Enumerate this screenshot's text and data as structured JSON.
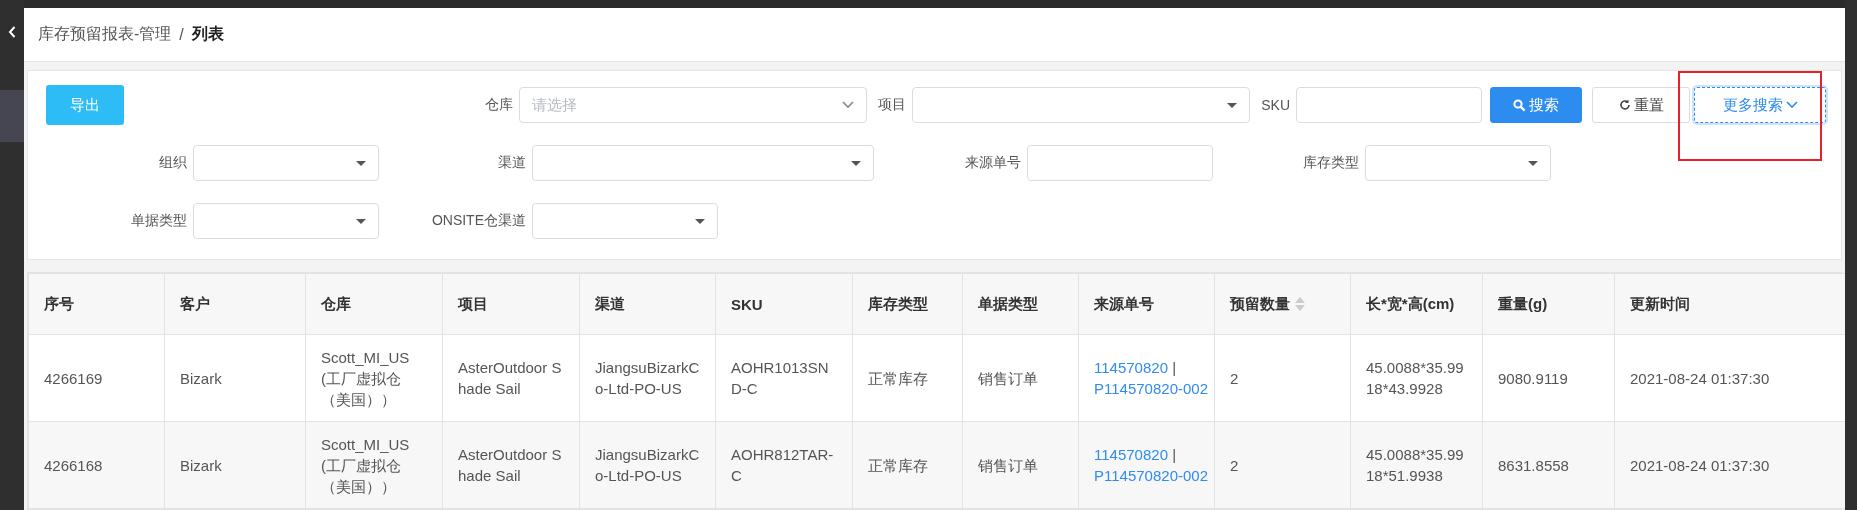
{
  "breadcrumb": {
    "parent": "库存预留报表-管理",
    "separator": "/",
    "current": "列表"
  },
  "filter_rows": [
    {
      "items": [
        {
          "kind": "export",
          "label": "导出"
        },
        {
          "kind": "select",
          "label": "仓库",
          "placeholder": "请选择"
        },
        {
          "kind": "dropdown",
          "label": "项目"
        },
        {
          "kind": "input",
          "label": "SKU"
        },
        {
          "kind": "search",
          "label": "搜索"
        },
        {
          "kind": "reset",
          "label": "重置"
        },
        {
          "kind": "more",
          "label": "更多搜索",
          "focused": true,
          "highlighted": true
        }
      ]
    },
    {
      "items": [
        {
          "kind": "dropdown",
          "label": "组织"
        },
        {
          "kind": "dropdown",
          "label": "渠道"
        },
        {
          "kind": "input",
          "label": "来源单号"
        },
        {
          "kind": "dropdown",
          "label": "库存类型"
        }
      ]
    },
    {
      "items": [
        {
          "kind": "dropdown",
          "label": "单据类型"
        },
        {
          "kind": "dropdown",
          "label": "ONSITE仓渠道"
        }
      ]
    }
  ],
  "table": {
    "columns": [
      {
        "label": "序号",
        "sortable": false
      },
      {
        "label": "客户",
        "sortable": false
      },
      {
        "label": "仓库",
        "sortable": false
      },
      {
        "label": "项目",
        "sortable": false
      },
      {
        "label": "渠道",
        "sortable": false
      },
      {
        "label": "SKU",
        "sortable": false
      },
      {
        "label": "库存类型",
        "sortable": false
      },
      {
        "label": "单据类型",
        "sortable": false
      },
      {
        "label": "来源单号",
        "sortable": false
      },
      {
        "label": "预留数量",
        "sortable": true
      },
      {
        "label": "长*宽*高(cm)",
        "sortable": false
      },
      {
        "label": "重量(g)",
        "sortable": false
      },
      {
        "label": "更新时间",
        "sortable": false
      }
    ],
    "rows": [
      {
        "cells": [
          "4266169",
          "Bizark",
          "Scott_MI_US(工厂虚拟仓（美国））",
          "AsterOutdoor Shade Sail",
          "JiangsuBizarkCo-Ltd-PO-US",
          "AOHR1013SND-C",
          "正常库存",
          "销售订单",
          {
            "links": [
              "114570820",
              "P114570820-002"
            ],
            "separator": "|"
          },
          "2",
          "45.0088*35.9918*43.9928",
          "9080.9119",
          "2021-08-24 01:37:30"
        ]
      },
      {
        "cells": [
          "4266168",
          "Bizark",
          "Scott_MI_US(工厂虚拟仓（美国））",
          "AsterOutdoor Shade Sail",
          "JiangsuBizarkCo-Ltd-PO-US",
          "AOHR812TAR-C",
          "正常库存",
          "销售订单",
          {
            "links": [
              "114570820",
              "P114570820-002"
            ],
            "separator": "|"
          },
          "2",
          "45.0088*35.9918*51.9938",
          "8631.8558",
          "2021-08-24 01:37:30"
        ]
      }
    ]
  }
}
